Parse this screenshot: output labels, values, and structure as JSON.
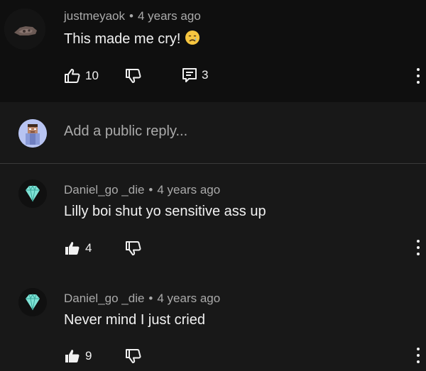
{
  "comment": {
    "author": "justmeyaok",
    "time": "4 years ago",
    "text": "This made me cry!",
    "emoji": "crying-face",
    "likes": "10",
    "replies": "3"
  },
  "reply_box": {
    "placeholder": "Add a public reply..."
  },
  "replies": [
    {
      "author": "Daniel_go _die",
      "time": "4 years ago",
      "text": "Lilly boi shut yo sensitive ass up",
      "likes": "4",
      "avatar_icon": "diamond-icon"
    },
    {
      "author": "Daniel_go _die",
      "time": "4 years ago",
      "text": "Never mind I just cried",
      "likes": "9",
      "avatar_icon": "diamond-icon"
    }
  ],
  "separator": "•",
  "colors": {
    "background": "#181818",
    "top_background": "#0f0f0f",
    "primary_text": "#f1f1f1",
    "secondary_text": "#aaaaaa",
    "diamond": "#7fe3d6"
  }
}
